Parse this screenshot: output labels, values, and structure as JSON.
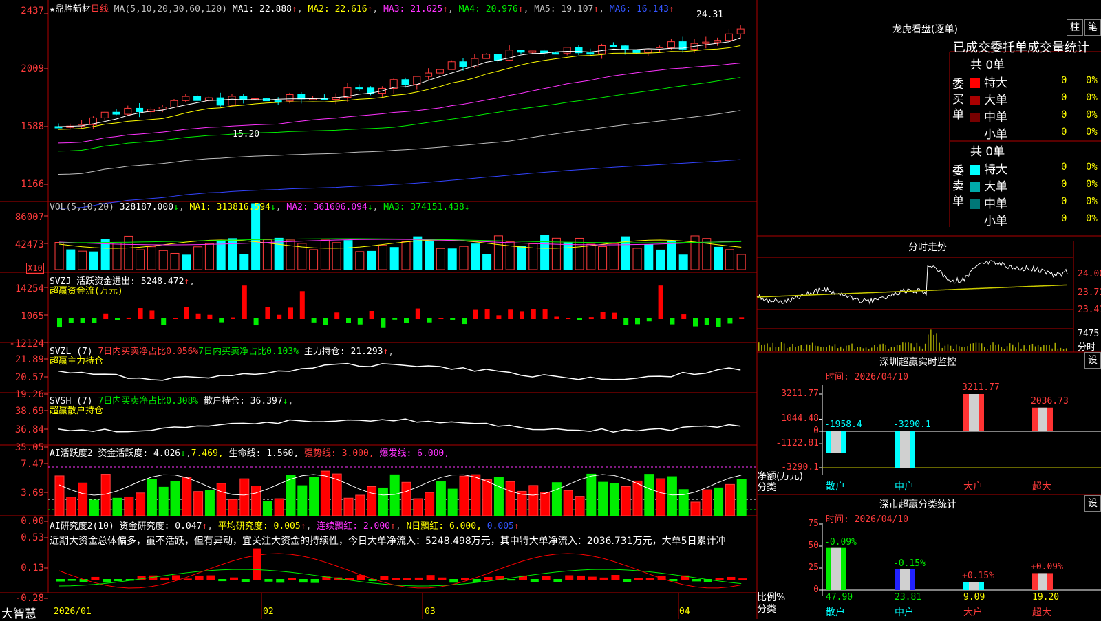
{
  "stock": {
    "name": "★鼎胜新材",
    "period": "日线",
    "ma_spec": "MA(5,10,20,30,60,120)",
    "ma": [
      {
        "label": "MA1:",
        "value": "22.888"
      },
      {
        "label": "MA2:",
        "value": "22.616"
      },
      {
        "label": "MA3:",
        "value": "21.625"
      },
      {
        "label": "MA4:",
        "value": "20.976"
      },
      {
        "label": "MA5:",
        "value": "19.107"
      },
      {
        "label": "MA6:",
        "value": "16.143"
      }
    ],
    "axis": [
      "2437",
      "2009",
      "1588",
      "1166"
    ],
    "high_label": "24.31",
    "low_label": "15.20"
  },
  "vol": {
    "spec": "VOL(5,10,20)",
    "value": "328187.000",
    "ma1": "MA1: 313816.594",
    "ma2": "MA2: 361606.094",
    "ma3": "MA3: 374151.438",
    "axis": [
      "86007",
      "42473"
    ],
    "unit": "X10"
  },
  "svzj": {
    "title": "SVZJ  活跃资金进出: 5248.472",
    "sub": "超赢资金流(万元)",
    "axis": [
      "14254",
      "1065",
      "-12124"
    ]
  },
  "svzl": {
    "title": "SVZL (7)",
    "t1": "7日内买卖净占比0.056%",
    "t2": "7日内买卖净占比0.103%",
    "t3": "主力持仓: 21.293",
    "sub": "超赢主力持仓",
    "axis": [
      "21.89",
      "20.57",
      "19.26"
    ]
  },
  "svsh": {
    "title": "SVSH (7)",
    "t1": "7日内买卖净占比0.308%",
    "t2": "散户持仓: 36.397",
    "sub": "超赢散户持仓",
    "axis": [
      "38.69",
      "36.84",
      "35.05"
    ]
  },
  "ai1": {
    "title": "AI活跃度2",
    "t1": "资金活跃度: 4.026",
    "t2": "7.469,",
    "t3": "生命线: 1.560,",
    "t4": "强势线: 3.000,",
    "t5": "爆发线: 6.000,",
    "axis": [
      "7.47",
      "3.69",
      "0.00"
    ]
  },
  "ai2": {
    "title": "AI研究度2(10)",
    "t1": "资金研究度: 0.047",
    "t2": "平均研究度: 0.005",
    "t3": "连续飘红: 2.000",
    "t4": "N日飘红: 6.000,",
    "t5": "0.005",
    "comment": "近期大资金总体偏多，虽不活跃，但有异动，宜关注大资金的持续性，今日大单净流入：5248.498万元，其中特大单净流入：2036.731万元，大单5日累计冲",
    "axis": [
      "0.53",
      "0.13",
      "-0.28"
    ]
  },
  "xaxis": {
    "brand": "大智慧",
    "labels": [
      "2026/01",
      "02",
      "03",
      "04"
    ]
  },
  "lhb": {
    "title": "龙虎看盘(逐单)",
    "btn1": "柱",
    "btn2": "笔",
    "tabs": "已成交委托单成交量统计",
    "buy": {
      "side": "委买单",
      "total": "共 0单",
      "rows": [
        {
          "n": "特大",
          "c": "#ff0000",
          "q": "0",
          "p": "0%"
        },
        {
          "n": "大单",
          "c": "#aa0000",
          "q": "0",
          "p": "0%"
        },
        {
          "n": "中单",
          "c": "#770000",
          "q": "0",
          "p": "0%"
        },
        {
          "n": "小单",
          "c": "#000000",
          "q": "0",
          "p": "0%"
        }
      ]
    },
    "sell": {
      "side": "委卖单",
      "total": "共 0单",
      "rows": [
        {
          "n": "特大",
          "c": "#00ffff",
          "q": "0",
          "p": "0%"
        },
        {
          "n": "大单",
          "c": "#00aaaa",
          "q": "0",
          "p": "0%"
        },
        {
          "n": "中单",
          "c": "#007777",
          "q": "0",
          "p": "0%"
        },
        {
          "n": "小单",
          "c": "#000000",
          "q": "0",
          "p": "0%"
        }
      ]
    }
  },
  "intraday": {
    "title": "分时走势",
    "axis": [
      "24.00",
      "23.71",
      "23.41"
    ],
    "vol_label": "7475",
    "vol_unit": "分时"
  },
  "sz_monitor": {
    "title": "深圳超赢实时监控",
    "set": "设",
    "time": "时间: 2026/04/10",
    "axis": [
      "3211.77",
      "1044.48",
      "0",
      "-1122.81",
      "-3290.1"
    ],
    "ylabel1": "净额(万元)",
    "ylabel2": "分类",
    "bars": [
      {
        "cat": "散户",
        "value": -1958.4,
        "label": "-1958.4"
      },
      {
        "cat": "中户",
        "value": -3290.1,
        "label": "-3290.1"
      },
      {
        "cat": "大户",
        "value": 3211.77,
        "label": "3211.77"
      },
      {
        "cat": "超大",
        "value": 2036.73,
        "label": "2036.73"
      }
    ]
  },
  "sz_class": {
    "title": "深市超赢分类统计",
    "set": "设",
    "time": "时间: 2026/04/10",
    "axis": [
      "75",
      "50",
      "25",
      "0"
    ],
    "ylabel1": "比例%",
    "ylabel2": "分类",
    "bars": [
      {
        "cat": "散户",
        "value": 47.9,
        "label": "47.90",
        "chg": "-0.09%"
      },
      {
        "cat": "中户",
        "value": 23.81,
        "label": "23.81",
        "chg": "-0.15%"
      },
      {
        "cat": "大户",
        "value": 9.09,
        "label": "9.09",
        "chg": "+0.15%"
      },
      {
        "cat": "超大",
        "value": 19.2,
        "label": "19.20",
        "chg": "+0.09%"
      }
    ]
  },
  "chart_data": {
    "type": "bar",
    "title": "深圳超赢实时监控",
    "categories": [
      "散户",
      "中户",
      "大户",
      "超大"
    ],
    "series": [
      {
        "name": "净额(万元)",
        "values": [
          -1958.4,
          -3290.1,
          3211.77,
          2036.73
        ]
      },
      {
        "name": "比例%",
        "values": [
          47.9,
          23.81,
          9.09,
          19.2
        ]
      }
    ],
    "ylim": [
      -3290.1,
      3211.77
    ]
  }
}
